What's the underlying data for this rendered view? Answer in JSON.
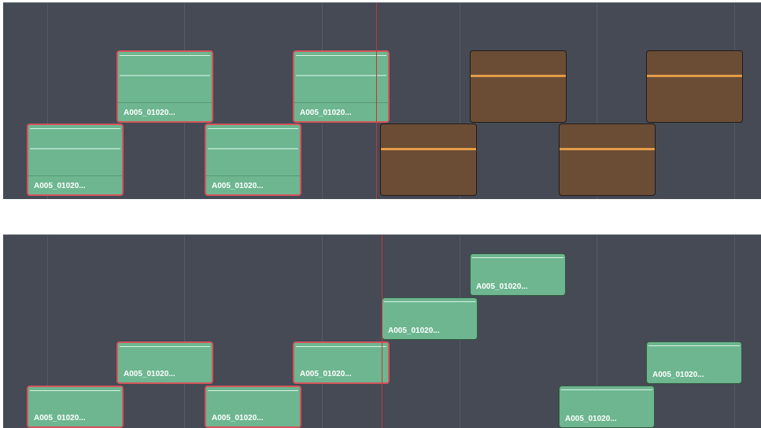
{
  "timelines": {
    "top": {
      "clips": [
        {
          "label": "A005_01020...",
          "kind": "audio",
          "selected": true
        },
        {
          "label": "A005_01020...",
          "kind": "audio",
          "selected": true
        },
        {
          "label": "A005_01020...",
          "kind": "audio",
          "selected": true
        },
        {
          "label": "A005_01020...",
          "kind": "audio",
          "selected": true
        },
        {
          "label": "",
          "kind": "orange",
          "selected": false
        },
        {
          "label": "",
          "kind": "orange",
          "selected": false
        },
        {
          "label": "",
          "kind": "orange",
          "selected": false
        },
        {
          "label": "",
          "kind": "orange",
          "selected": false
        }
      ]
    },
    "bottom": {
      "clips": [
        {
          "label": "A005_01020...",
          "kind": "audio",
          "selected": true
        },
        {
          "label": "A005_01020...",
          "kind": "audio",
          "selected": true
        },
        {
          "label": "A005_01020...",
          "kind": "audio",
          "selected": true
        },
        {
          "label": "A005_01020...",
          "kind": "audio",
          "selected": true
        },
        {
          "label": "A005_01020...",
          "kind": "audio",
          "selected": false
        },
        {
          "label": "A005_01020...",
          "kind": "audio",
          "selected": false
        },
        {
          "label": "A005_01020...",
          "kind": "audio",
          "selected": false
        },
        {
          "label": "A005_01020...",
          "kind": "audio",
          "selected": false
        }
      ]
    }
  },
  "colors": {
    "timeline_bg": "#454a55",
    "clip_green": "#6db690",
    "clip_orange": "#6b4d36",
    "selection_outline": "#d4555c",
    "playhead": "#c7353a"
  }
}
